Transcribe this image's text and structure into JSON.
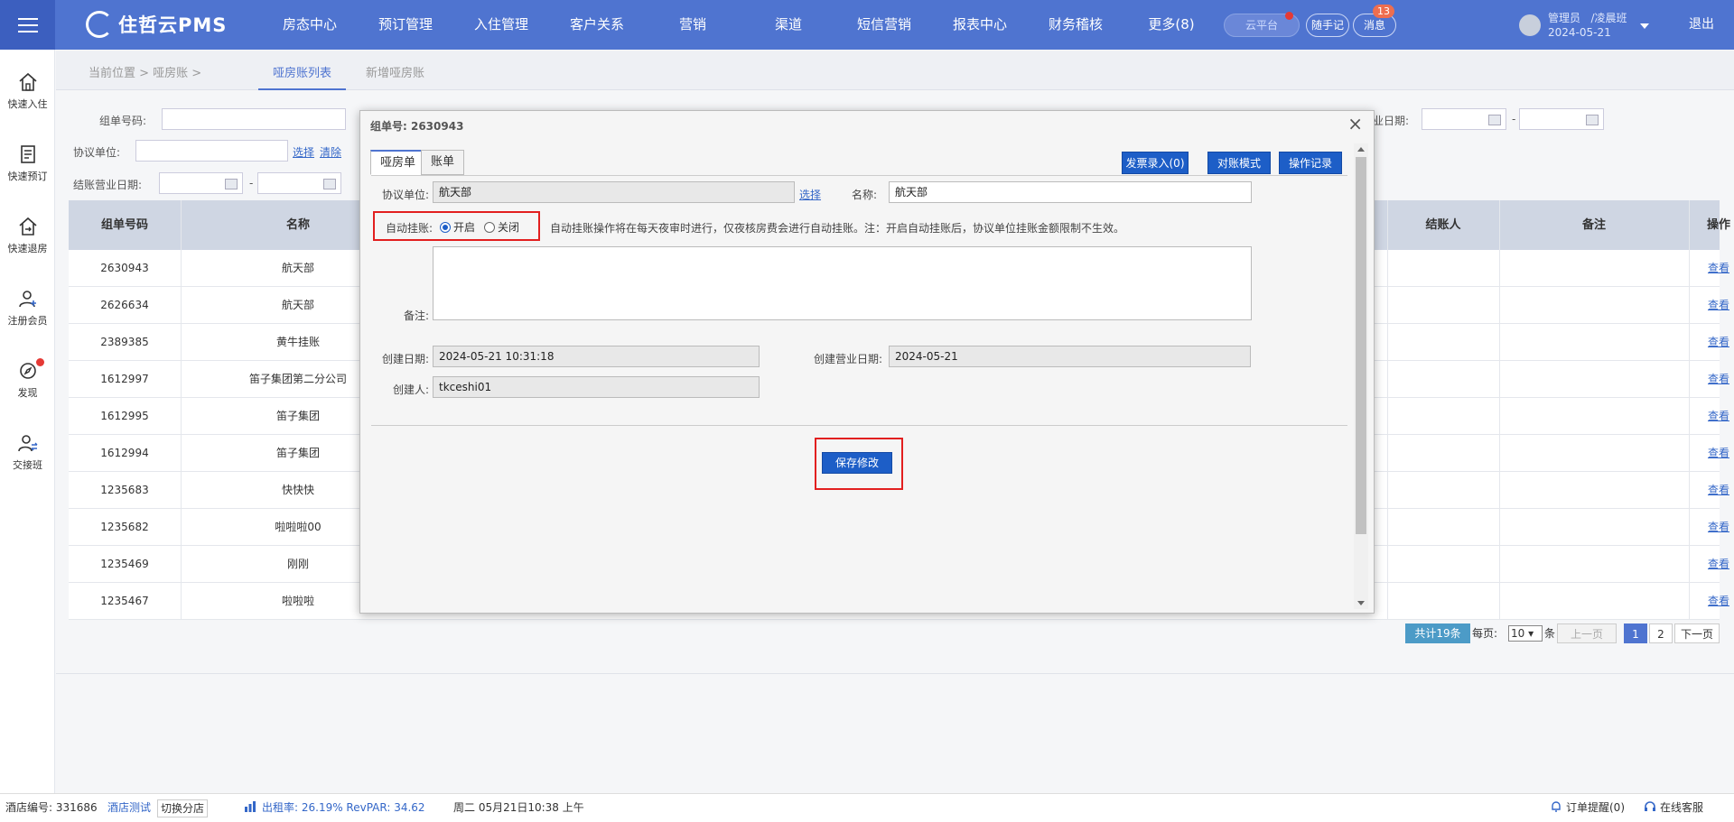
{
  "topbar": {
    "brand": "住哲云PMS",
    "nav": [
      "房态中心",
      "预订管理",
      "入住管理",
      "客户关系",
      "营销",
      "渠道",
      "短信营销",
      "报表中心",
      "财务稽核",
      "更多(8)"
    ],
    "cloud_platform": "云平台",
    "notes": "随手记",
    "messages": "消息",
    "message_count": "13",
    "user_role": "管理员",
    "user_shift": "/凌晨班",
    "user_date": "2024-05-21",
    "logout": "退出"
  },
  "sidebar": [
    {
      "label": "快速入住",
      "icon": "home-icon"
    },
    {
      "label": "快速预订",
      "icon": "clipboard-icon"
    },
    {
      "label": "快速退房",
      "icon": "checkout-icon"
    },
    {
      "label": "注册会员",
      "icon": "user-add-icon"
    },
    {
      "label": "发现",
      "icon": "discover-icon"
    },
    {
      "label": "交接班",
      "icon": "shift-change-icon"
    }
  ],
  "breadcrumb": {
    "location": "当前位置 > 哑房账 >",
    "tabs": [
      "哑房账列表",
      "新增哑房账"
    ]
  },
  "filters": {
    "group_no": "组单号码:",
    "agreement_unit": "协议单位:",
    "select": "选择",
    "clear": "清除",
    "settle_date": "结账营业日期:",
    "business_date": "业日期:",
    "dash": "-"
  },
  "table": {
    "headers": [
      "组单号码",
      "名称",
      "结账人",
      "备注",
      "操作"
    ],
    "rows": [
      {
        "id": "2630943",
        "name": "航天部",
        "action": "查看"
      },
      {
        "id": "2626634",
        "name": "航天部",
        "action": "查看"
      },
      {
        "id": "2389385",
        "name": "黄牛挂账",
        "action": "查看"
      },
      {
        "id": "1612997",
        "name": "笛子集团第二分公司",
        "action": "查看"
      },
      {
        "id": "1612995",
        "name": "笛子集团",
        "action": "查看"
      },
      {
        "id": "1612994",
        "name": "笛子集团",
        "action": "查看"
      },
      {
        "id": "1235683",
        "name": "快快快",
        "action": "查看"
      },
      {
        "id": "1235682",
        "name": "啦啦啦00",
        "action": "查看"
      },
      {
        "id": "1235469",
        "name": "刚刚",
        "action": "查看"
      },
      {
        "id": "1235467",
        "name": "啦啦啦",
        "action": "查看"
      }
    ]
  },
  "pager": {
    "total": "共计19条",
    "per_page_label": "每页:",
    "per_page": "10",
    "unit": "条",
    "prev": "上一页",
    "pages": [
      "1",
      "2"
    ],
    "next": "下一页"
  },
  "statusbar": {
    "hotel_no": "酒店编号: 331686",
    "hotel_name": "酒店测试",
    "switch": "切换分店",
    "occupancy": "出租率: 26.19% RevPAR: 34.62",
    "datetime": "周二 05月21日10:38 上午",
    "order_reminder": "订单提醒(0)",
    "online_service": "在线客服"
  },
  "dialog": {
    "title": "组单号: 2630943",
    "close": "×",
    "tabs": [
      "哑房单",
      "账单"
    ],
    "buttons": [
      "发票录入(0)",
      "对账模式",
      "操作记录"
    ],
    "agreement_label": "协议单位:",
    "agreement_value": "航天部",
    "select_link": "选择",
    "name_label": "名称:",
    "name_value": "航天部",
    "auto_label": "自动挂账:",
    "auto_on": "开启",
    "auto_off": "关闭",
    "auto_note": "自动挂账操作将在每天夜审时进行，仅夜核房费会进行自动挂账。注：开启自动挂账后，协议单位挂账金额限制不生效。",
    "remark_label": "备注:",
    "created_label": "创建日期:",
    "created_value": "2024-05-21 10:31:18",
    "created_biz_label": "创建营业日期:",
    "created_biz_value": "2024-05-21",
    "creator_label": "创建人:",
    "creator_value": "tkceshi01",
    "save": "保存修改"
  }
}
